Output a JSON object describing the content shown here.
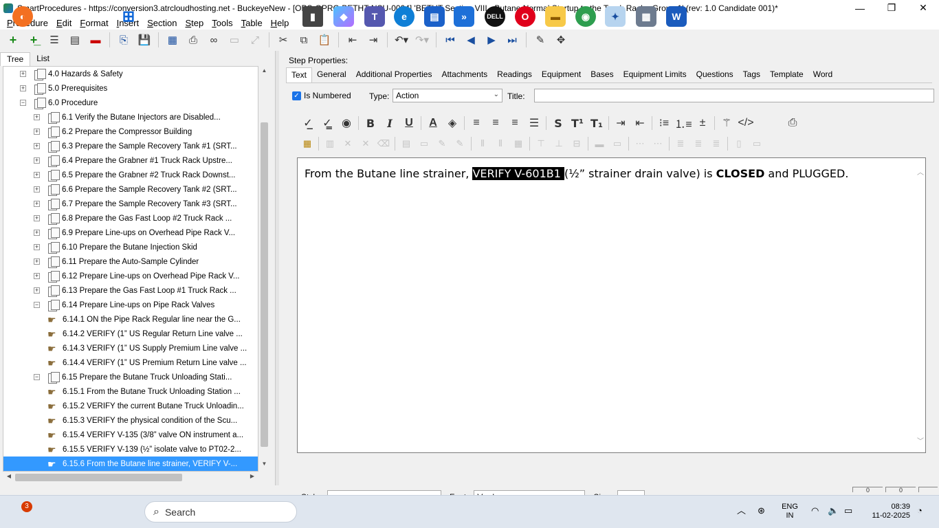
{
  "window": {
    "title": "SmartProcedures - https://conversion3.atrcloudhosting.net - BuckeyeNew - [OPS-OPRC-BETHT-NSU-0004] 'BETHT Section VIII - Butane Normal Startup to the Truck Rack - Group 1' (rev: 1.0 Candidate 001)*",
    "minimize": "—",
    "maximize": "❐",
    "close": "✕"
  },
  "menu": [
    {
      "first": "P",
      "rest": "rocedure"
    },
    {
      "first": "E",
      "rest": "dit"
    },
    {
      "first": "F",
      "rest": "ormat"
    },
    {
      "first": "I",
      "rest": "nsert"
    },
    {
      "first": "S",
      "rest": "ection"
    },
    {
      "first": "S",
      "rest": "tep"
    },
    {
      "first": "T",
      "rest": "ools"
    },
    {
      "first": "T",
      "rest": "able"
    },
    {
      "first": "H",
      "rest": "elp"
    }
  ],
  "left_tabs": {
    "tree": "Tree",
    "list": "List"
  },
  "tree": [
    {
      "label": "4.0 Hazards & Safety",
      "level": 0,
      "kind": "doc",
      "expander": "+"
    },
    {
      "label": "5.0 Prerequisites",
      "level": 0,
      "kind": "doc",
      "expander": "+"
    },
    {
      "label": "6.0 Procedure",
      "level": 0,
      "kind": "doc",
      "expander": "−"
    },
    {
      "label": "6.1 Verify the Butane Injectors are Disabled...",
      "level": 1,
      "kind": "doc",
      "expander": "+"
    },
    {
      "label": "6.2 Prepare the Compressor Building",
      "level": 1,
      "kind": "doc",
      "expander": "+"
    },
    {
      "label": "6.3 Prepare the Sample Recovery Tank #1 (SRT...",
      "level": 1,
      "kind": "doc",
      "expander": "+"
    },
    {
      "label": "6.4 Prepare the Grabner #1 Truck Rack Upstre...",
      "level": 1,
      "kind": "doc",
      "expander": "+"
    },
    {
      "label": "6.5 Prepare the Grabner #2 Truck Rack Downst...",
      "level": 1,
      "kind": "doc",
      "expander": "+"
    },
    {
      "label": "6.6 Prepare the Sample Recovery Tank #2 (SRT...",
      "level": 1,
      "kind": "doc",
      "expander": "+"
    },
    {
      "label": "6.7 Prepare the Sample Recovery Tank #3 (SRT...",
      "level": 1,
      "kind": "doc",
      "expander": "+"
    },
    {
      "label": "6.8 Prepare the Gas Fast Loop #2 Truck Rack ...",
      "level": 1,
      "kind": "doc",
      "expander": "+"
    },
    {
      "label": "6.9 Prepare Line-ups on Overhead Pipe Rack V...",
      "level": 1,
      "kind": "doc",
      "expander": "+"
    },
    {
      "label": "6.10 Prepare the Butane Injection Skid",
      "level": 1,
      "kind": "doc",
      "expander": "+"
    },
    {
      "label": "6.11 Prepare the Auto-Sample Cylinder",
      "level": 1,
      "kind": "doc",
      "expander": "+"
    },
    {
      "label": "6.12 Prepare Line-ups on Overhead Pipe Rack V...",
      "level": 1,
      "kind": "doc",
      "expander": "+"
    },
    {
      "label": "6.13 Prepare the Gas Fast Loop #1 Truck Rack ...",
      "level": 1,
      "kind": "doc",
      "expander": "+"
    },
    {
      "label": "6.14 Prepare Line-ups on Pipe Rack Valves",
      "level": 1,
      "kind": "doc",
      "expander": "−"
    },
    {
      "label": "6.14.1 ON the Pipe Rack Regular line near the G...",
      "level": 2,
      "kind": "step",
      "expander": ""
    },
    {
      "label": "6.14.2 VERIFY (1” US Regular Return Line valve ...",
      "level": 2,
      "kind": "step",
      "expander": ""
    },
    {
      "label": "6.14.3 VERIFY (1” US Supply Premium Line valve ...",
      "level": 2,
      "kind": "step",
      "expander": ""
    },
    {
      "label": "6.14.4 VERIFY (1” US Premium Return Line valve ...",
      "level": 2,
      "kind": "step",
      "expander": ""
    },
    {
      "label": "6.15 Prepare the Butane Truck Unloading Stati...",
      "level": 1,
      "kind": "doc",
      "expander": "−"
    },
    {
      "label": "6.15.1 From the Butane Truck Unloading Station ...",
      "level": 2,
      "kind": "step",
      "expander": ""
    },
    {
      "label": "6.15.2 VERIFY the current Butane Truck Unloadin...",
      "level": 2,
      "kind": "step",
      "expander": ""
    },
    {
      "label": "6.15.3 VERIFY the physical condition of the Scu...",
      "level": 2,
      "kind": "step",
      "expander": ""
    },
    {
      "label": "6.15.4 VERIFY V-135 (3/8” valve ON instrument a...",
      "level": 2,
      "kind": "step",
      "expander": ""
    },
    {
      "label": "6.15.5 VERIFY V-139 (½” isolate valve to PT02-2...",
      "level": 2,
      "kind": "step",
      "expander": ""
    },
    {
      "label": "6.15.6 From the Butane line strainer, VERIFY V-...",
      "level": 2,
      "kind": "step",
      "expander": "",
      "selected": true
    }
  ],
  "step_properties": {
    "label": "Step Properties:",
    "tabs": [
      "Text",
      "General",
      "Additional Properties",
      "Attachments",
      "Readings",
      "Equipment",
      "Bases",
      "Equipment Limits",
      "Questions",
      "Tags",
      "Template",
      "Word"
    ],
    "active_tab": "Text",
    "is_numbered_label": "Is Numbered",
    "is_numbered_checked": true,
    "type_label": "Type:",
    "type_value": "Action",
    "title_label": "Title:",
    "title_value": ""
  },
  "editor": {
    "before": "From the Butane line strainer, ",
    "highlight": "VERIFY V-601B1 ",
    "middle": "(½” strainer drain valve) is ",
    "bold": "CLOSED",
    "after": " and PLUGGED."
  },
  "bottom": {
    "style_label": "Style:",
    "style_value": "",
    "font_label": "Font:",
    "font_value": "Verdana",
    "size_label": "Size:",
    "size_value": ""
  },
  "status_segments": [
    "0",
    "0"
  ],
  "taskbar": {
    "notification_count": "3",
    "search_placeholder": "Search",
    "language": "ENG",
    "region": "IN",
    "time": "08:39",
    "date": "11-02-2025"
  }
}
